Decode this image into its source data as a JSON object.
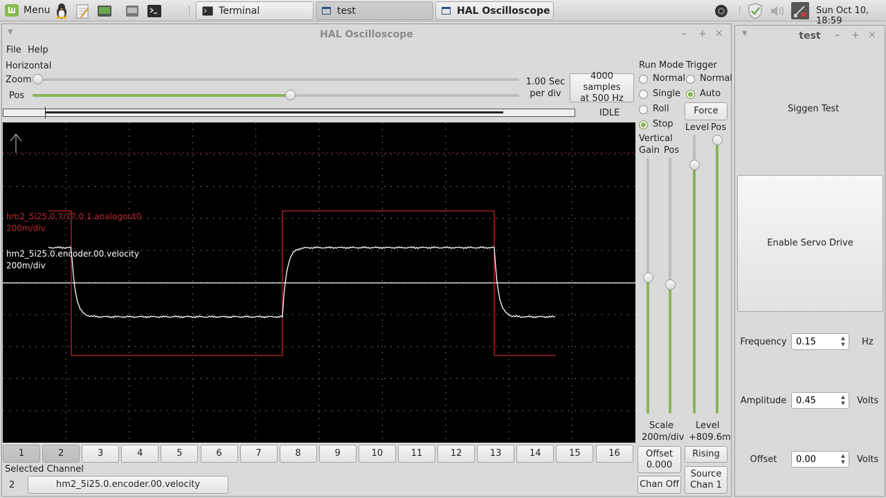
{
  "taskbar": {
    "menu_label": "Menu",
    "windows": [
      {
        "title": "Terminal"
      },
      {
        "title": "test"
      },
      {
        "title": "HAL Oscilloscope"
      }
    ],
    "clock": "Sun Oct 10, 18:59"
  },
  "scope": {
    "title": "HAL Oscilloscope",
    "menu": {
      "file": "File",
      "help": "Help"
    },
    "horizontal": {
      "section_label": "Horizontal",
      "zoom_label": "Zoom",
      "pos_label": "Pos",
      "zoom_level": 0.0,
      "pos_level": 0.53,
      "time_readout": "1.00 Sec\nper div",
      "samples_button": "4000 samples\nat 500 Hz"
    },
    "status": "IDLE",
    "run_mode": {
      "label": "Run Mode",
      "options": [
        "Normal",
        "Single",
        "Roll",
        "Stop"
      ],
      "selected": "Stop"
    },
    "trigger": {
      "label": "Trigger",
      "options": [
        "Normal",
        "Auto"
      ],
      "selected": "Auto",
      "force_button": "Force",
      "level_label": "Level",
      "pos_label": "Pos",
      "level_readout_label": "Level",
      "level_readout_value": "+809.6m",
      "edge_button": "Rising",
      "source_button": "Source\nChan 1"
    },
    "vertical": {
      "label": "Vertical",
      "gain_label": "Gain",
      "pos_label": "Pos",
      "scale_label": "Scale",
      "scale_value": "200m/div",
      "offset_button": "Offset\n0.000",
      "chan_off_button": "Chan Off"
    },
    "traces": [
      {
        "name": "hm2_5i25.0.7i77.0.1.analogout0",
        "scale": "200m/div",
        "color": "#c0272d"
      },
      {
        "name": "hm2_5i25.0.encoder.00.velocity",
        "scale": "200m/div",
        "color": "#ffffff"
      }
    ],
    "channels": [
      "1",
      "2",
      "3",
      "4",
      "5",
      "6",
      "7",
      "8",
      "9",
      "10",
      "11",
      "12",
      "13",
      "14",
      "15",
      "16"
    ],
    "active_channels": [
      "1",
      "2"
    ],
    "selected_channel_label": "Selected Channel",
    "selected_channel_number": "2",
    "selected_channel_name": "hm2_5i25.0.encoder.00.velocity"
  },
  "test_panel": {
    "title": "test",
    "siggen_label": "Siggen Test",
    "enable_button": "Enable Servo Drive",
    "fields": [
      {
        "label": "Frequency",
        "value": "0.15",
        "unit": "Hz"
      },
      {
        "label": "Amplitude",
        "value": "0.45",
        "unit": "Volts"
      },
      {
        "label": "Offset",
        "value": "0.00",
        "unit": "Volts"
      }
    ]
  },
  "colors": {
    "accent": "#8bb35a",
    "scope_bg": "#000000",
    "trace1": "#c0272d",
    "trace2": "#ffffff"
  }
}
